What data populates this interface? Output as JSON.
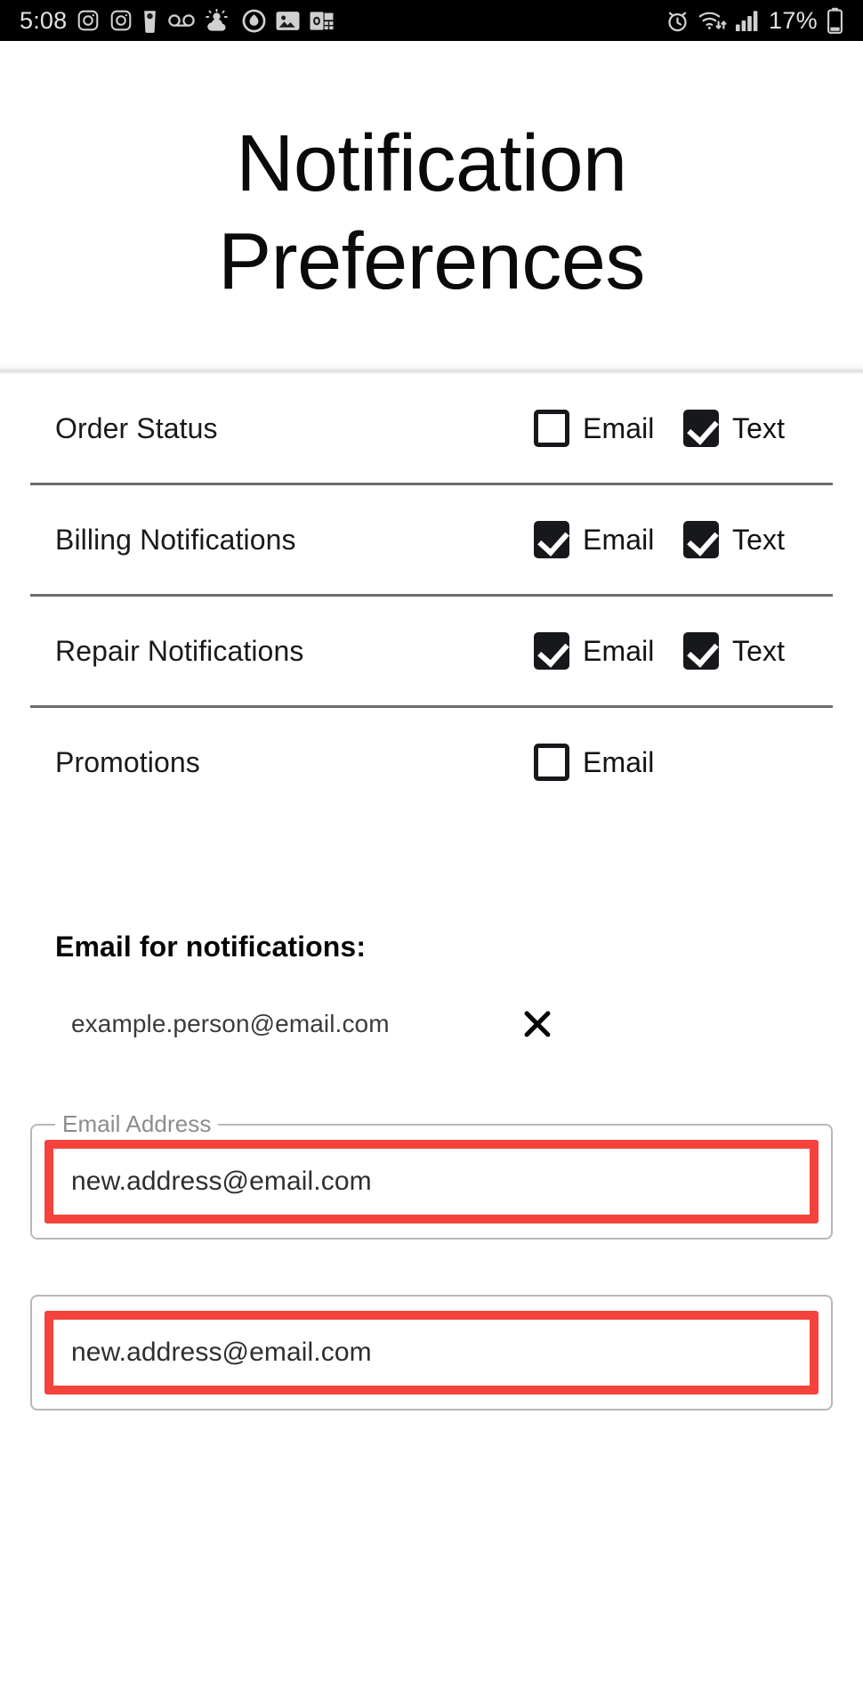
{
  "status_bar": {
    "time": "5:08",
    "battery_percent": "17%",
    "left_icons": [
      "instagram-icon",
      "instagram-icon",
      "coffee-cup-icon",
      "voicemail-icon",
      "weather-partly-sunny-icon",
      "contrast-droplet-icon",
      "photos-gallery-icon",
      "outlook-icon"
    ],
    "right_icons": [
      "alarm-clock-icon",
      "wifi-data-transfer-icon",
      "cellular-signal-icon",
      "battery-low-icon"
    ]
  },
  "header": {
    "title": "Notification Preferences"
  },
  "preferences": {
    "email_option_label": "Email",
    "text_option_label": "Text",
    "rows": [
      {
        "label": "Order Status",
        "email_checked": false,
        "has_text": true,
        "text_checked": true
      },
      {
        "label": "Billing Notifications",
        "email_checked": true,
        "has_text": true,
        "text_checked": true
      },
      {
        "label": "Repair Notifications",
        "email_checked": true,
        "has_text": true,
        "text_checked": true
      },
      {
        "label": "Promotions",
        "email_checked": false,
        "has_text": false,
        "text_checked": false
      }
    ]
  },
  "email_section": {
    "heading": "Email for notifications:",
    "current_email": "example.person@email.com",
    "remove_icon": "close-x-icon"
  },
  "form": {
    "field1": {
      "legend": "Email Address",
      "value": "new.address@email.com",
      "placeholder": "Email Address",
      "highlighted": true
    },
    "field2": {
      "value": "new.address@email.com",
      "placeholder": "Email Address",
      "highlighted": true
    },
    "highlight_color": "#f4433c"
  }
}
